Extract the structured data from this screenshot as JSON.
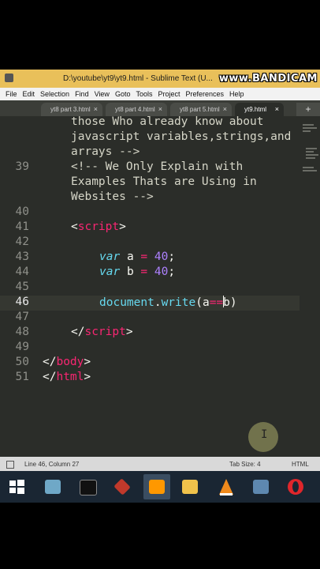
{
  "window": {
    "title": "D:\\youtube\\yt9\\yt9.html - Sublime Text (U...",
    "watermark": "www.BANDICAM"
  },
  "menu": [
    "File",
    "Edit",
    "Selection",
    "Find",
    "View",
    "Goto",
    "Tools",
    "Project",
    "Preferences",
    "Help"
  ],
  "tabs": [
    {
      "label": "yt8 part 3.html",
      "close": "×",
      "active": false
    },
    {
      "label": "yt8 part 4.html",
      "close": "×",
      "active": false
    },
    {
      "label": "yt8 part 5.html",
      "close": "×",
      "active": false
    },
    {
      "label": "yt9.html",
      "close": "×",
      "active": true
    }
  ],
  "tab_add": "+",
  "editor": {
    "lines": [
      {
        "n": "",
        "text": "those Who already know about"
      },
      {
        "n": "",
        "text": "javascript variables,strings,and"
      },
      {
        "n": "",
        "text": "arrays -->"
      },
      {
        "n": "39",
        "text": "<!-- We Only Explain with"
      },
      {
        "n": "",
        "text": "Examples Thats are Using in"
      },
      {
        "n": "",
        "text": "Websites -->"
      },
      {
        "n": "40",
        "text": ""
      },
      {
        "n": "41",
        "open": "<",
        "tag": "script",
        "close": ">"
      },
      {
        "n": "42",
        "text": ""
      },
      {
        "n": "43",
        "kw": "var",
        "name": "a",
        "eq": "=",
        "num": "40",
        "semi": ";"
      },
      {
        "n": "44",
        "kw": "var",
        "name": "b",
        "eq": "=",
        "num": "40",
        "semi": ";"
      },
      {
        "n": "45",
        "text": ""
      },
      {
        "n": "46",
        "obj": "document",
        "dot": ".",
        "fn": "write",
        "arg1": "(a",
        "op": "==",
        "arg2": "b)"
      },
      {
        "n": "47",
        "text": ""
      },
      {
        "n": "48",
        "open": "</",
        "tag": "script",
        "close": ">"
      },
      {
        "n": "49",
        "text": ""
      },
      {
        "n": "50",
        "open": "</",
        "tag": "body",
        "close": ">"
      },
      {
        "n": "51",
        "open": "</",
        "tag": "html",
        "close": ">"
      }
    ]
  },
  "status": {
    "position": "Line 46, Column 27",
    "tab_size": "Tab Size: 4",
    "syntax": "HTML"
  },
  "colors": {
    "titlebar": "#e9c05a",
    "editor_bg": "#2b2d29",
    "comment": "#d6d6c8",
    "tag": "#f92672",
    "keyword": "#66d9ef",
    "number": "#ae81ff"
  },
  "taskbar_apps": [
    "windows-start-icon",
    "file-explorer-icon",
    "command-prompt-icon",
    "sketchup-icon",
    "sublime-text-icon",
    "folder-icon",
    "vlc-icon",
    "screen-recorder-icon",
    "opera-icon"
  ]
}
